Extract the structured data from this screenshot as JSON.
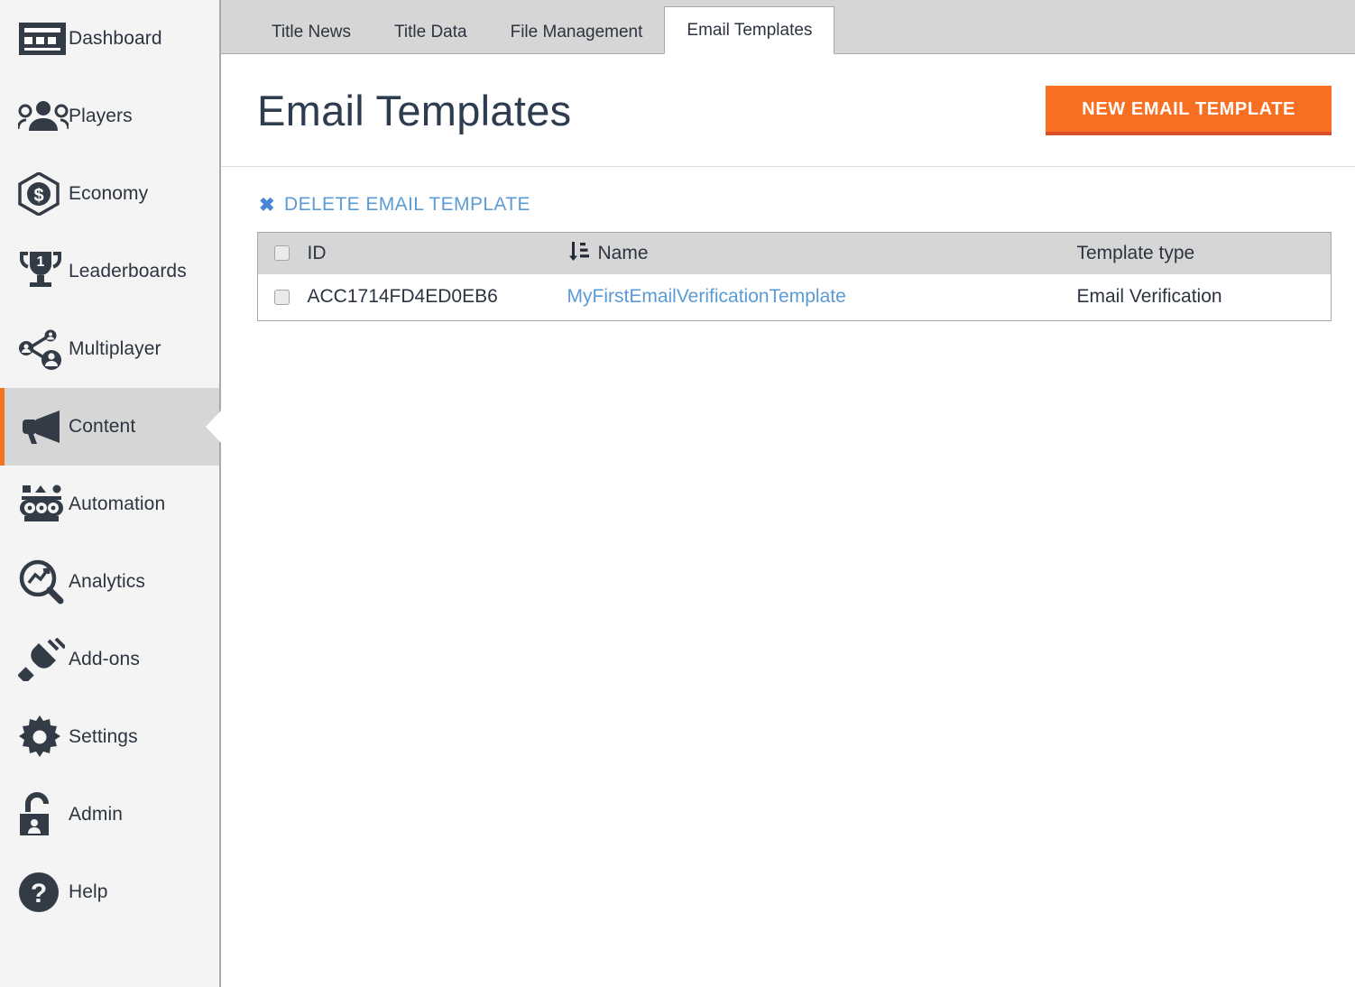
{
  "colors": {
    "accent_orange": "#f96f21",
    "accent_orange_dark": "#d9502a",
    "link_blue": "#5b9bd5",
    "sidebar_bg": "#f4f4f4",
    "sidebar_active_bg": "#d6d6d6",
    "tabbar_bg": "#d6d6d6",
    "text_dark": "#2c3440",
    "title_color": "#2e3c4f"
  },
  "sidebar": {
    "items": [
      {
        "label": "Dashboard",
        "icon": "dashboard-icon",
        "active": false
      },
      {
        "label": "Players",
        "icon": "players-icon",
        "active": false
      },
      {
        "label": "Economy",
        "icon": "economy-icon",
        "active": false
      },
      {
        "label": "Leaderboards",
        "icon": "trophy-icon",
        "active": false
      },
      {
        "label": "Multiplayer",
        "icon": "multiplayer-icon",
        "active": false
      },
      {
        "label": "Content",
        "icon": "megaphone-icon",
        "active": true
      },
      {
        "label": "Automation",
        "icon": "automation-icon",
        "active": false
      },
      {
        "label": "Analytics",
        "icon": "analytics-icon",
        "active": false
      },
      {
        "label": "Add-ons",
        "icon": "plug-icon",
        "active": false
      },
      {
        "label": "Settings",
        "icon": "gear-icon",
        "active": false
      },
      {
        "label": "Admin",
        "icon": "unlock-user-icon",
        "active": false
      },
      {
        "label": "Help",
        "icon": "question-icon",
        "active": false
      }
    ]
  },
  "tabs": [
    {
      "label": "Title News",
      "active": false
    },
    {
      "label": "Title Data",
      "active": false
    },
    {
      "label": "File Management",
      "active": false
    },
    {
      "label": "Email Templates",
      "active": true
    }
  ],
  "header": {
    "title": "Email Templates",
    "new_button_label": "NEW EMAIL TEMPLATE"
  },
  "toolbar": {
    "delete_label": "DELETE EMAIL TEMPLATE",
    "delete_icon": "close-x-icon"
  },
  "table": {
    "sort_icon": "sort-ascending-icon",
    "sort_column": "Name",
    "select_all_checked": false,
    "columns": [
      "ID",
      "Name",
      "Template type"
    ],
    "rows": [
      {
        "checked": false,
        "id": "ACC1714FD4ED0EB6",
        "name": "MyFirstEmailVerificationTemplate",
        "type": "Email Verification"
      }
    ]
  }
}
